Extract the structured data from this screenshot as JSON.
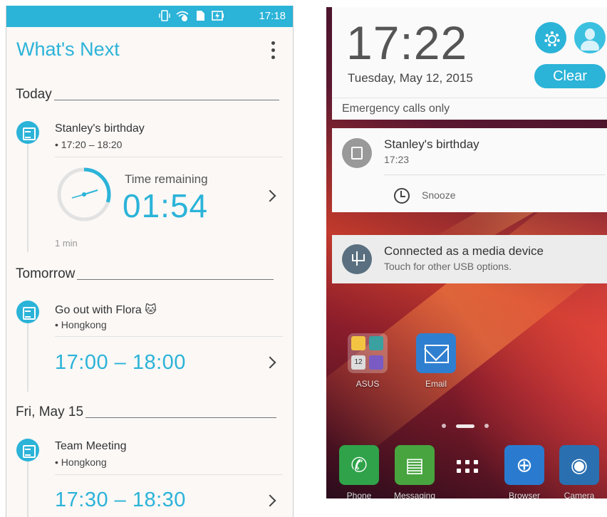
{
  "left": {
    "status_time": "17:18",
    "app_title": "What's Next",
    "sections": [
      {
        "heading": "Today"
      },
      {
        "heading": "Tomorrow"
      },
      {
        "heading": "Fri, May 15"
      }
    ],
    "events": [
      {
        "title": "Stanley's birthday",
        "sub": "• 17:20 – 18:20"
      },
      {
        "title": "Go out with Flora",
        "emoji": "🐱",
        "sub": "• Hongkong",
        "time": "17:00 – 18:00"
      },
      {
        "title": "Team Meeting",
        "sub": "• Hongkong",
        "time": "17:30 – 18:30"
      }
    ],
    "countdown": {
      "label": "Time remaining",
      "value": "01:54",
      "min_label": "1 min",
      "progress": 0.3
    }
  },
  "right": {
    "clock": "17:22",
    "date": "Tuesday, May 12, 2015",
    "clear_label": "Clear",
    "emergency": "Emergency calls only",
    "notif1": {
      "title": "Stanley's birthday",
      "time": "17:23",
      "action": "Snooze"
    },
    "notif2": {
      "title": "Connected as a media device",
      "sub": "Touch for other USB options."
    },
    "apps": [
      {
        "label": "ASUS",
        "icon": "folder-icon"
      },
      {
        "label": "Email",
        "icon": "email-icon"
      }
    ],
    "folder_badge": "12",
    "dock": [
      {
        "label": "Phone",
        "icon": "phone-icon"
      },
      {
        "label": "Messaging",
        "icon": "message-icon"
      },
      {
        "label": "Browser",
        "icon": "globe-icon"
      },
      {
        "label": "Camera",
        "icon": "camera-icon"
      }
    ]
  }
}
